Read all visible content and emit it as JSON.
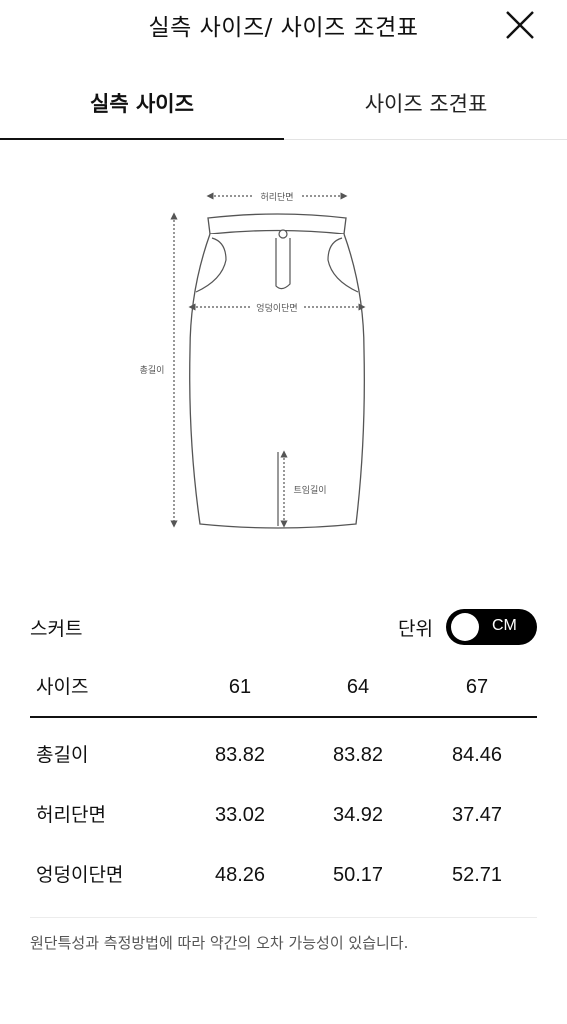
{
  "header": {
    "title": "실측 사이즈/ 사이즈 조견표"
  },
  "tabs": [
    {
      "label": "실측 사이즈"
    },
    {
      "label": "사이즈 조견표"
    }
  ],
  "diagram": {
    "waist_label": "허리단면",
    "hip_label": "엉덩이단면",
    "length_label": "총길이",
    "slit_label": "트임길이"
  },
  "section": {
    "title": "스커트",
    "unit_label": "단위",
    "unit_value": "CM"
  },
  "table": {
    "header_label": "사이즈",
    "sizes": [
      "61",
      "64",
      "67"
    ],
    "rows": [
      {
        "label": "총길이",
        "values": [
          "83.82",
          "83.82",
          "84.46"
        ]
      },
      {
        "label": "허리단면",
        "values": [
          "33.02",
          "34.92",
          "37.47"
        ]
      },
      {
        "label": "엉덩이단면",
        "values": [
          "48.26",
          "50.17",
          "52.71"
        ]
      }
    ]
  },
  "note": "원단특성과 측정방법에 따라 약간의 오차 가능성이 있습니다.",
  "colors": {
    "text": "#111111",
    "toggle_bg": "#000000",
    "diagram_line": "#555555"
  }
}
